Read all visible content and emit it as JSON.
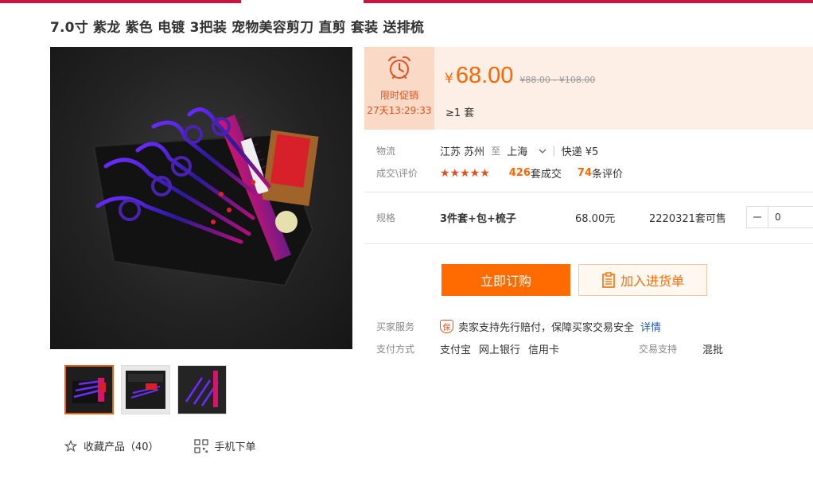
{
  "product": {
    "title": "7.0寸 紫龙 紫色 电镀 3把装 宠物美容剪刀 直剪 套装 送排梳"
  },
  "promo": {
    "label": "限时促销",
    "countdown": "27天13:29:33",
    "icon": "alarm-clock-icon"
  },
  "price": {
    "currency": "¥",
    "value": "68.00",
    "range": "¥88.00 - ¥108.00",
    "moq": "≥1 套"
  },
  "logistics": {
    "label": "物流",
    "from": "江苏 苏州",
    "to_word": "至",
    "to": "上海",
    "express": "快递 ¥5"
  },
  "deals": {
    "label": "成交\\评价",
    "stars": "★★★★★",
    "sold_count": "426",
    "sold_suffix": "套成交",
    "review_count": "74",
    "review_suffix": "条评价"
  },
  "spec": {
    "label": "规格",
    "name": "3件套+包+梳子",
    "price": "68.00元",
    "stock": "2220321套可售",
    "quantity": "0"
  },
  "buttons": {
    "order": "立即订购",
    "cart": "加入进货单"
  },
  "service": {
    "label": "买家服务",
    "badge": "保",
    "text": "卖家支持先行赔付，保障买家交易安全",
    "link": "详情"
  },
  "payment": {
    "label": "支付方式",
    "methods": [
      "支付宝",
      "网上银行",
      "信用卡"
    ],
    "trade_label": "交易支持",
    "trade_value": "混批"
  },
  "actions": {
    "favorite": "收藏产品（40）",
    "mobile_order": "手机下单"
  },
  "colors": {
    "accent": "#ff6600",
    "brand_top": "#c8163f",
    "promo_bg": "#fbd9c7",
    "link": "#1f5bb4"
  }
}
